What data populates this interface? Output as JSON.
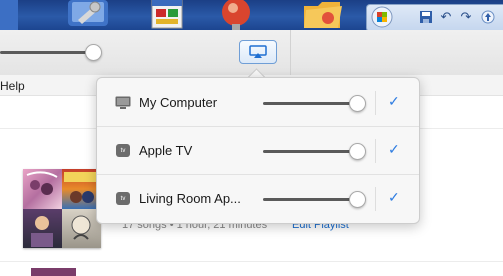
{
  "desktop": {
    "icons": [
      "app-icon",
      "wrench-tool-icon",
      "window-app-icon",
      "globe-icon",
      "folder-icon"
    ]
  },
  "quick_access": {
    "buttons": [
      "office-logo-icon",
      "save-icon",
      "undo-icon",
      "redo-icon",
      "up-arrow-icon"
    ]
  },
  "toolbar": {
    "volume_level": 0.92,
    "airplay_icon": "airplay-icon"
  },
  "menu": {
    "help_label": "Help"
  },
  "playlist": {
    "meta": "17 songs • 1 hour, 21 minutes",
    "edit_label": "Edit Playlist"
  },
  "airplay_popover": {
    "devices": [
      {
        "name": "My Computer",
        "icon": "computer-icon",
        "volume": 0.98,
        "selected": true
      },
      {
        "name": "Apple TV",
        "icon": "appletv-icon",
        "badge": "tv",
        "volume": 0.98,
        "selected": true
      },
      {
        "name": "Living Room Ap...",
        "icon": "appletv-icon",
        "badge": "tv",
        "volume": 0.98,
        "selected": true
      }
    ],
    "check_glyph": "✓"
  },
  "colors": {
    "accent": "#2f7de1",
    "link": "#1c6fd0"
  }
}
